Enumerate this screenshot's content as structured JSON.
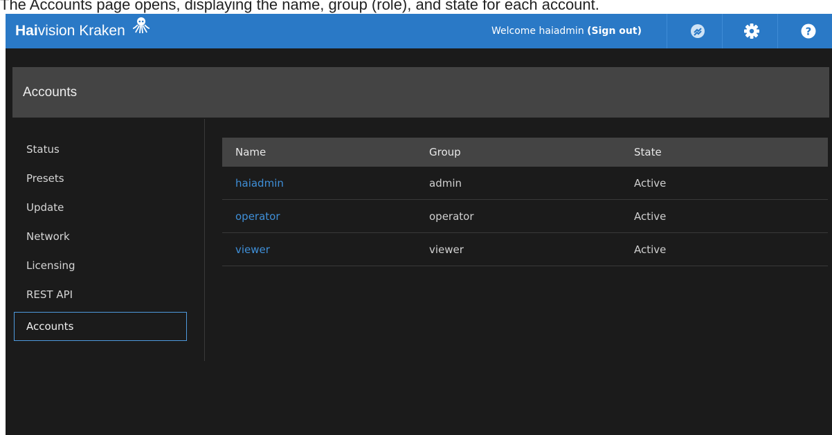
{
  "caption": "The Accounts page opens, displaying the name, group (role), and state for each account.",
  "app": {
    "brand_strong": "Hai",
    "brand_rest": "vision Kraken",
    "welcome_prefix": "Welcome haiadmin ",
    "sign_out": "(Sign out)",
    "icons": [
      "sync-status-icon",
      "gear-icon",
      "help-icon"
    ],
    "accent_color": "#2a79c6"
  },
  "page": {
    "title": "Accounts"
  },
  "sidebar": {
    "items": [
      {
        "label": "Status"
      },
      {
        "label": "Presets"
      },
      {
        "label": "Update"
      },
      {
        "label": "Network"
      },
      {
        "label": "Licensing"
      },
      {
        "label": "REST API"
      },
      {
        "label": "Accounts",
        "active": true
      }
    ]
  },
  "accounts_table": {
    "columns": [
      "Name",
      "Group",
      "State"
    ],
    "rows": [
      {
        "name": "haiadmin",
        "group": "admin",
        "state": "Active"
      },
      {
        "name": "operator",
        "group": "operator",
        "state": "Active"
      },
      {
        "name": "viewer",
        "group": "viewer",
        "state": "Active"
      }
    ]
  }
}
